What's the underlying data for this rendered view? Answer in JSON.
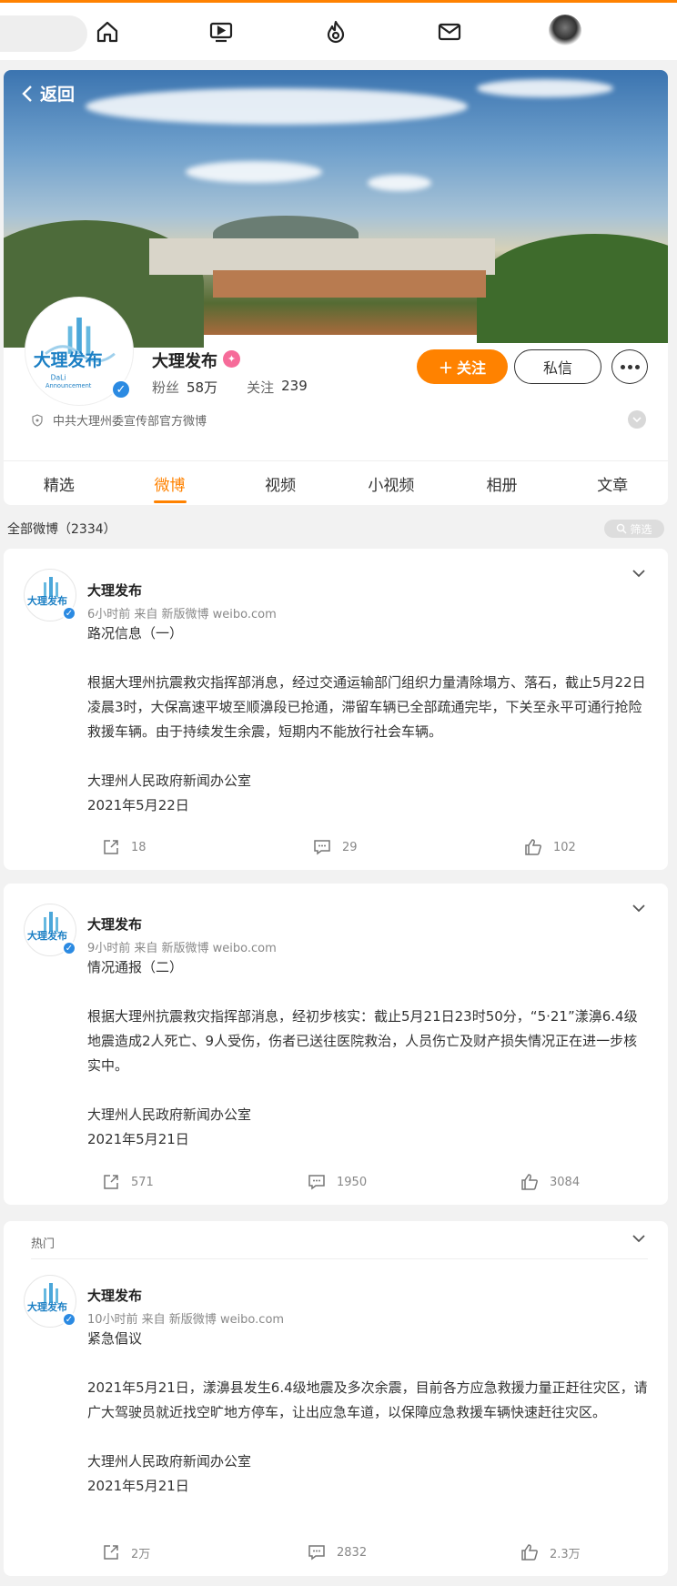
{
  "nav": {
    "items": [
      "home-icon",
      "video-icon",
      "hot-icon",
      "message-icon",
      "profile-avatar"
    ]
  },
  "profile": {
    "back_label": "返回",
    "name": "大理发布",
    "fans_label": "粉丝",
    "fans_value": "58万",
    "follow_count_label": "关注",
    "follow_count_value": "239",
    "follow_button": "关注",
    "message_button": "私信",
    "description": "中共大理州委宣传部官方微博",
    "logo_text": "大理发布",
    "logo_sub": "DaLi",
    "logo_sub2": "Announcement"
  },
  "tabs": [
    {
      "label": "精选",
      "active": false
    },
    {
      "label": "微博",
      "active": true
    },
    {
      "label": "视频",
      "active": false
    },
    {
      "label": "小视频",
      "active": false
    },
    {
      "label": "相册",
      "active": false
    },
    {
      "label": "文章",
      "active": false
    }
  ],
  "feed": {
    "all_label": "全部微博（2334）",
    "filter_label": "筛选"
  },
  "posts": [
    {
      "author": "大理发布",
      "meta": "6小时前  来自 新版微博 weibo.com",
      "title": "路况信息（一）",
      "paragraph": "根据大理州抗震救灾指挥部消息，经过交通运输部门组织力量清除塌方、落石，截止5月22日凌晨3时，大保高速平坡至顺濞段已抢通，滞留车辆已全部疏通完毕，下关至永平可通行抢险救援车辆。由于持续发生余震，短期内不能放行社会车辆。",
      "signature": "大理州人民政府新闻办公室",
      "date": "2021年5月22日",
      "reposts": "18",
      "comments": "29",
      "likes": "102"
    },
    {
      "author": "大理发布",
      "meta": "9小时前  来自 新版微博 weibo.com",
      "title": "情况通报（二）",
      "paragraph": "根据大理州抗震救灾指挥部消息，经初步核实：截止5月21日23时50分，“5·21”漾濞6.4级地震造成2人死亡、9人受伤，伤者已送往医院救治，人员伤亡及财产损失情况正在进一步核实中。",
      "signature": "大理州人民政府新闻办公室",
      "date": "2021年5月21日",
      "reposts": "571",
      "comments": "1950",
      "likes": "3084"
    },
    {
      "hot_label": "热门",
      "author": "大理发布",
      "meta": "10小时前  来自 新版微博 weibo.com",
      "title": "紧急倡议",
      "paragraph": "2021年5月21日，漾濞县发生6.4级地震及多次余震，目前各方应急救援力量正赶往灾区，请广大驾驶员就近找空旷地方停车，让出应急车道，以保障应急救援车辆快速赶往灾区。",
      "signature": "大理州人民政府新闻办公室",
      "date": "2021年5月21日",
      "reposts": "2万",
      "comments": "2832",
      "likes": "2.3万"
    }
  ],
  "colors": {
    "accent": "#ff8200",
    "verified": "#2b8ae2",
    "vip": "#f66b99"
  }
}
